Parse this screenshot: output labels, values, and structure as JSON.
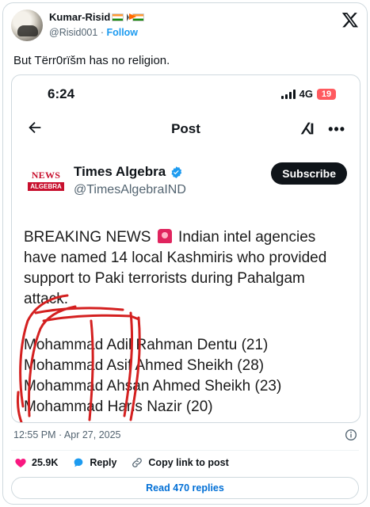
{
  "author": {
    "display_name": "Kumar-Risid",
    "handle": "@Risid001",
    "follow_label": "Follow"
  },
  "tweet": {
    "text": "But Tërr0rïšm has no religion.",
    "timestamp": "12:55 PM · Apr 27, 2025"
  },
  "screenshot": {
    "status_time": "6:24",
    "network": "4G",
    "battery": "19",
    "page_title": "Post",
    "account_name": "Times Algebra",
    "account_handle": "@TimesAlgebraIND",
    "logo_line1": "NEWS",
    "logo_line2": "ALGEBRA",
    "subscribe_label": "Subscribe",
    "body_before_icon": "BREAKING NEWS",
    "body_after_icon": "Indian intel agencies have named 14 local Kashmiris who provided support to Paki terrorists during Pahalgam attack.",
    "names": [
      "Mohammad Adil Rahman Dentu (21)",
      "Mohammad Asif Ahmed Sheikh (28)",
      "Mohammad Ahsan Ahmed Sheikh (23)",
      "Mohammad Haris Nazir (20)"
    ]
  },
  "actions": {
    "likes": "25.9K",
    "reply_label": "Reply",
    "copy_label": "Copy link to post",
    "read_replies": "Read 470 replies"
  },
  "colors": {
    "accent": "#1d9bf0",
    "like": "#f91880",
    "text": "#0f1419",
    "muted": "#536471",
    "scribble": "#d42020"
  },
  "icons": [
    "x-logo-icon",
    "back-arrow-icon",
    "grok-icon",
    "more-icon",
    "verified-icon",
    "siren-icon",
    "info-icon",
    "heart-icon",
    "reply-icon",
    "link-icon"
  ]
}
